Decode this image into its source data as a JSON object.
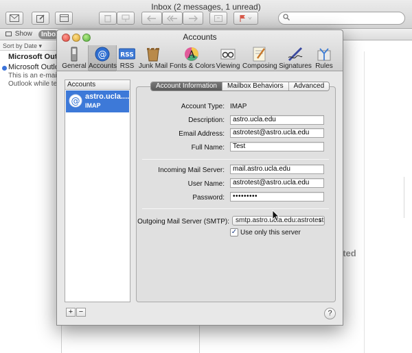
{
  "mail": {
    "window_title": "Inbox (2 messages, 1 unread)",
    "show_label": "Show",
    "inbox_label": "Inbox",
    "sort_label": "Sort by Date",
    "sort_arrow": "▾",
    "search_placeholder": "",
    "message": {
      "from": "Microsoft Outlook",
      "subject": "Microsoft Outlook",
      "preview_1": "This is an e-mail",
      "preview_2": "Outlook while tes"
    },
    "behind_text": "cted"
  },
  "prefs": {
    "window_title": "Accounts",
    "toolbar": [
      {
        "label": "General",
        "icon": "switch-icon"
      },
      {
        "label": "Accounts",
        "icon": "at-icon"
      },
      {
        "label": "RSS",
        "icon": "rss-icon"
      },
      {
        "label": "Junk Mail",
        "icon": "junk-mail-icon"
      },
      {
        "label": "Fonts & Colors",
        "icon": "fonts-colors-icon"
      },
      {
        "label": "Viewing",
        "icon": "glasses-icon"
      },
      {
        "label": "Composing",
        "icon": "composing-icon"
      },
      {
        "label": "Signatures",
        "icon": "signature-pen-icon"
      },
      {
        "label": "Rules",
        "icon": "rules-icon"
      }
    ],
    "selected_tab": "Accounts",
    "accounts_header": "Accounts",
    "account": {
      "name": "astro.ucla....",
      "type": "IMAP"
    },
    "add_label": "+",
    "remove_label": "−",
    "help_label": "?",
    "tabs": [
      "Account Information",
      "Mailbox Behaviors",
      "Advanced"
    ],
    "active_tab": "Account Information",
    "fields": {
      "account_type_label": "Account Type:",
      "account_type_value": "IMAP",
      "description_label": "Description:",
      "description_value": "astro.ucla.edu",
      "email_label": "Email Address:",
      "email_value": "astrotest@astro.ucla.edu",
      "fullname_label": "Full Name:",
      "fullname_value": "Test",
      "incoming_label": "Incoming Mail Server:",
      "incoming_value": "mail.astro.ucla.edu",
      "username_label": "User Name:",
      "username_value": "astrotest@astro.ucla.edu",
      "password_label": "Password:",
      "password_value": "•••••••••",
      "smtp_label": "Outgoing Mail Server (SMTP):",
      "smtp_value": "smtp.astro.ucla.edu:astrotest",
      "use_only_label": "Use only this server",
      "use_only_checked": true,
      "check_mark": "✓"
    }
  }
}
